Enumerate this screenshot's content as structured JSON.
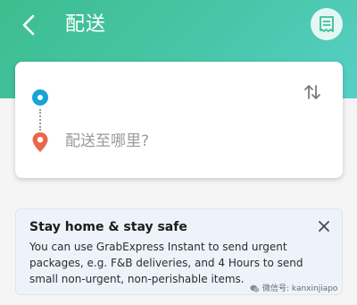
{
  "colors": {
    "header_start": "#3dbd8e",
    "header_end": "#57cfc6",
    "pickup": "#1aa3d8",
    "pin": "#e8684a",
    "banner_bg": "#eef3fb"
  },
  "header": {
    "title": "配送",
    "back_icon": "chevron-left-icon",
    "history_icon": "receipt-icon"
  },
  "route": {
    "pickup_value": "",
    "destination_placeholder": "配送至哪里?",
    "swap_icon": "swap-vertical-icon"
  },
  "banner": {
    "title": "Stay home & stay safe",
    "lines": [
      "You can use GrabExpress Instant to send urgent",
      "packages, e.g. F&B deliveries, and 4 Hours to send",
      "small non-urgent, non-perishable items."
    ],
    "close_icon": "close-icon"
  },
  "watermark": {
    "text": "微信号: kanxinjiapo"
  }
}
